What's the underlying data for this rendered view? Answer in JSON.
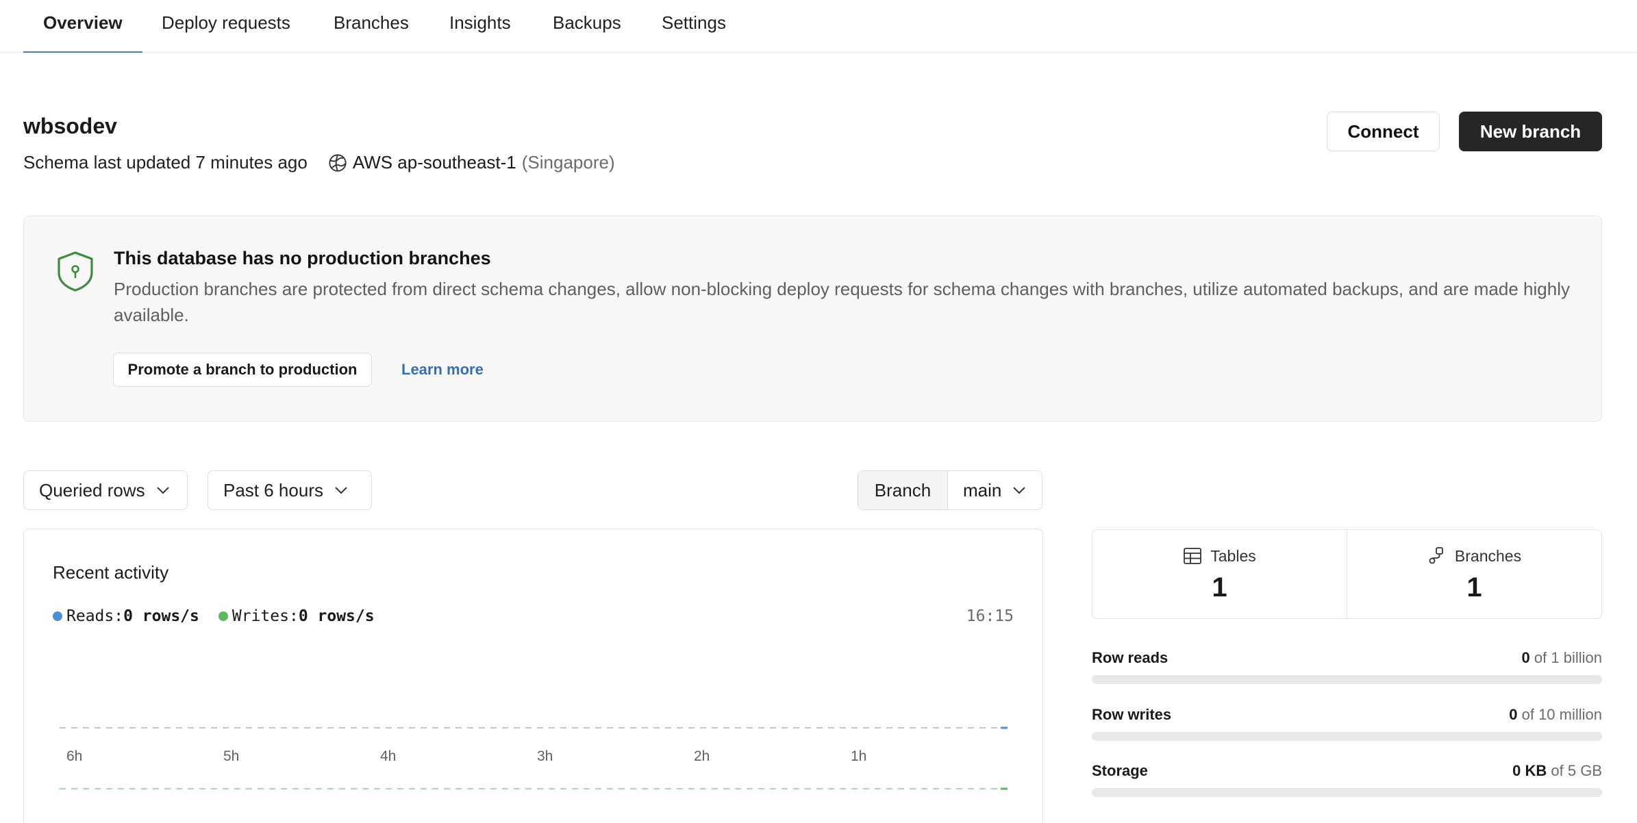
{
  "nav": {
    "tabs": [
      {
        "label": "Overview",
        "active": true
      },
      {
        "label": "Deploy requests"
      },
      {
        "label": "Branches"
      },
      {
        "label": "Insights"
      },
      {
        "label": "Backups"
      },
      {
        "label": "Settings"
      }
    ]
  },
  "header": {
    "db_name": "wbsodev",
    "schema_updated": "Schema last updated 7 minutes ago",
    "region": "AWS ap-southeast-1",
    "region_city": "(Singapore)",
    "connect_label": "Connect",
    "new_branch_label": "New branch"
  },
  "notice": {
    "title": "This database has no production branches",
    "body": "Production branches are protected from direct schema changes, allow non-blocking deploy requests for schema changes with branches, utilize automated backups, and are made highly available.",
    "promote_label": "Promote a branch to production",
    "learn_more_label": "Learn more",
    "shield_color": "#3d8a40"
  },
  "filters": {
    "metric": "Queried rows",
    "range": "Past 6 hours",
    "branch_label": "Branch",
    "branch_value": "main"
  },
  "activity": {
    "title": "Recent activity",
    "reads_label": "Reads:",
    "reads_value": "0 rows/s",
    "writes_label": "Writes:",
    "writes_value": "0 rows/s",
    "time": "16:15",
    "reads_color": "#4a90d9",
    "writes_color": "#5cb85c",
    "x_ticks": [
      "6h",
      "5h",
      "4h",
      "3h",
      "2h",
      "1h"
    ]
  },
  "stats": {
    "tables_label": "Tables",
    "tables_value": "1",
    "branches_label": "Branches",
    "branches_value": "1"
  },
  "usage": [
    {
      "label": "Row reads",
      "value": "0",
      "limit": "of 1 billion",
      "fraction": 0
    },
    {
      "label": "Row writes",
      "value": "0",
      "limit": "of 10 million",
      "fraction": 0
    },
    {
      "label": "Storage",
      "value": "0 KB",
      "limit": "of 5 GB",
      "fraction": 0
    }
  ]
}
